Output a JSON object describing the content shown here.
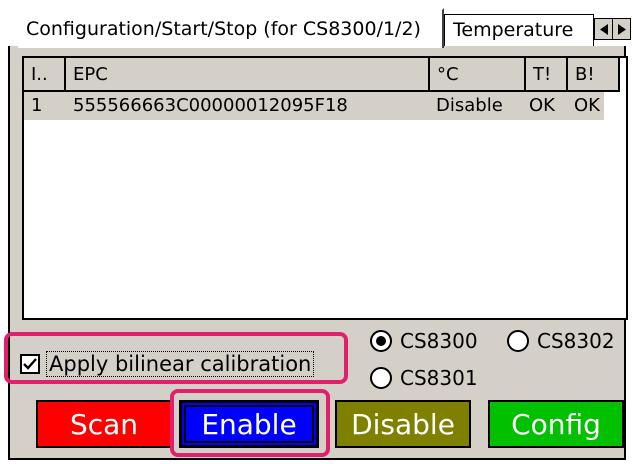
{
  "tabs": {
    "active_label": "Configuration/Start/Stop (for CS8300/1/2)",
    "inactive_label": "Temperature",
    "scroll_left_icon": "triangle-left-icon",
    "scroll_right_icon": "triangle-right-icon"
  },
  "table": {
    "columns": [
      "I..",
      "EPC",
      "°C",
      "T!",
      "B!"
    ],
    "rows": [
      {
        "index": "1",
        "epc": "555566663C00000012095F18",
        "temp": "Disable",
        "t": "OK",
        "b": "OK"
      }
    ]
  },
  "radios": {
    "cs8300": {
      "label": "CS8300",
      "checked": true
    },
    "cs8302": {
      "label": "CS8302",
      "checked": false
    },
    "cs8301": {
      "label": "CS8301",
      "checked": false
    }
  },
  "checkbox": {
    "label": "Apply bilinear calibration",
    "checked": true
  },
  "buttons": {
    "scan": {
      "label": "Scan",
      "color": "#ff0000"
    },
    "enable": {
      "label": "Enable",
      "color": "#0000ff"
    },
    "disable": {
      "label": "Disable",
      "color": "#808000"
    },
    "config": {
      "label": "Config",
      "color": "#00c000"
    }
  },
  "highlight_color": "#e01f6d"
}
